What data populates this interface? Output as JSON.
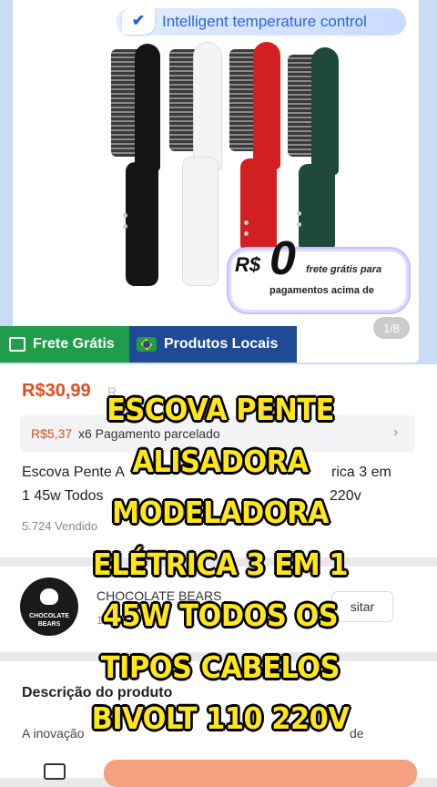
{
  "product_gallery": {
    "temperature_badge": "Intelligent temperature control",
    "promo_currency": "R$",
    "promo_amount": "0",
    "promo_line1": "frete grátis para",
    "promo_line2": "pagamentos acima de",
    "pager": "1/8",
    "tags": {
      "free_shipping": "Frete Grátis",
      "local_products": "Produtos Locais"
    },
    "brush_colors": [
      "#151515",
      "#f4f4f4",
      "#d21f1f",
      "#1f4a3a"
    ]
  },
  "pricing": {
    "price": "R$30,99",
    "old_price_fragment": "R",
    "installment_amount": "R$5,37",
    "installment_text": "x6 Pagamento parcelado"
  },
  "product": {
    "title_line1": "Escova Pente A",
    "title_line1_end": "rica 3 em",
    "title_line2": "1 45w Todos",
    "title_line2_end": "220v",
    "sold": "5.724 Vendido"
  },
  "seller": {
    "avatar_text": "CHOCOLATE BEARS",
    "name": "CHOCOLATE BEARS",
    "sub": "1",
    "visit_label": "sitar"
  },
  "description": {
    "title": "Descrição do produto",
    "text_start": "A inovação",
    "text_end": "de"
  },
  "overlay": {
    "lines": [
      "ESCOVA PENTE",
      "ALISADORA",
      "MODELADORA",
      "ELÉTRICA 3 EM 1",
      "45W TODOS OS",
      "TIPOS CABELOS",
      "BIVOLT 110 220V"
    ]
  }
}
